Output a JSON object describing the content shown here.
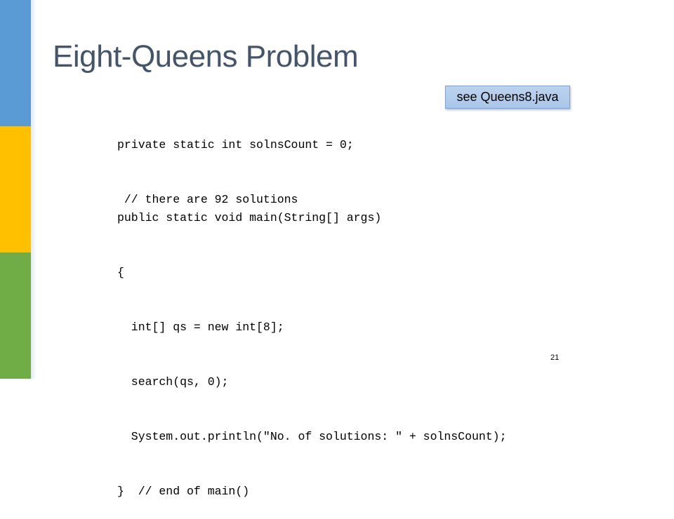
{
  "slide": {
    "title": "Eight-Queens Problem",
    "accent_colors": {
      "stripe_top": "#5b9bd5",
      "stripe_middle": "#ffc000",
      "stripe_bottom": "#70ad47",
      "title_color": "#44546a"
    },
    "callout": {
      "label": "see Queens8.java",
      "fill": "#a9c6ea"
    },
    "code_top": [
      "private static int solnsCount = 0;",
      " // there are 92 solutions"
    ],
    "code_main": [
      "public static void main(String[] args)",
      "{",
      "  int[] qs = new int[8];",
      "  search(qs, 0);",
      "  System.out.println(\"No. of solutions: \" + solnsCount);",
      "}  // end of main()"
    ],
    "page_number": "21"
  }
}
